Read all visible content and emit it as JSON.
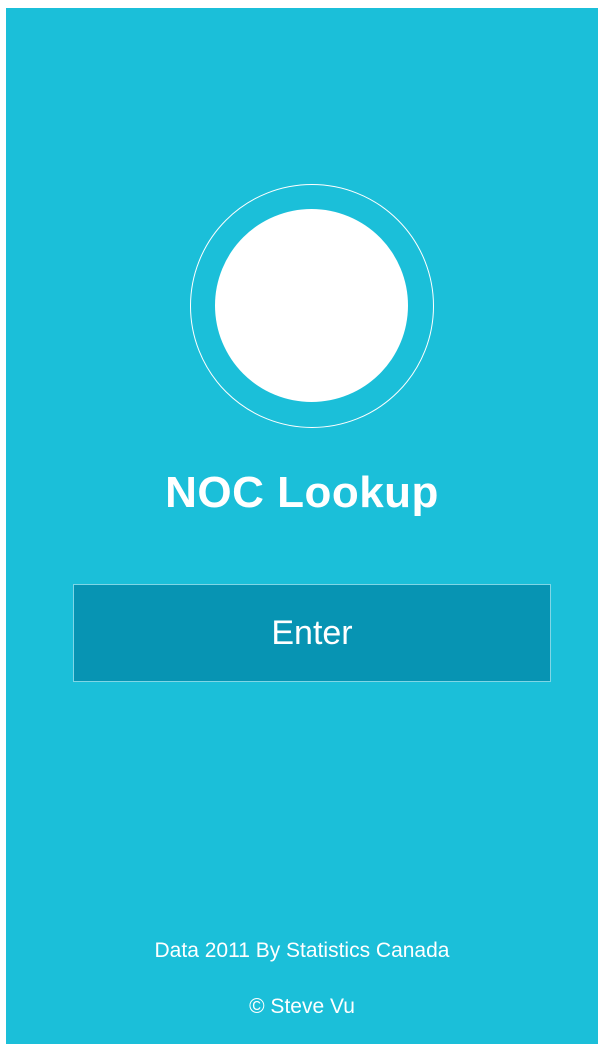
{
  "app": {
    "title": "NOC Lookup",
    "enter_label": "Enter"
  },
  "footer": {
    "data_credit": "Data 2011 By Statistics Canada",
    "copyright": "© Steve Vu"
  },
  "colors": {
    "background": "#1bbfd9",
    "button": "#0794b3",
    "button_border": "#7fd6e6",
    "text": "#ffffff"
  },
  "icons": {
    "logo": "circle-logo-icon"
  }
}
